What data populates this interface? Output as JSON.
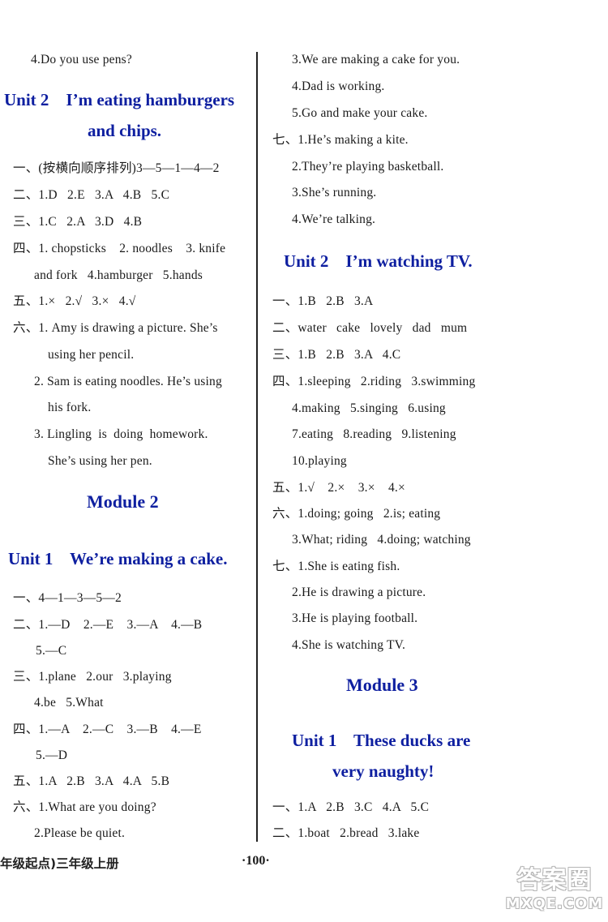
{
  "left_column": {
    "lines": [
      {
        "text": "4.Do you use pens?"
      },
      {
        "heading": "Unit 2    I’m eating hamburgers"
      },
      {
        "heading": "and chips."
      },
      {
        "text": "一、(按横向顺序排列)3—5—1—4—2"
      },
      {
        "text": "二、1.D   2.E   3.A   4.B   5.C"
      },
      {
        "text": "三、1.C   2.A   3.D   4.B"
      },
      {
        "text": "四、1. chopsticks    2. noodles    3. knife"
      },
      {
        "text": "and fork   4.hamburger   5.hands"
      },
      {
        "text": "五、1.×   2.√   3.×   4.√"
      },
      {
        "text": "六、1. Amy is drawing a picture. She’s"
      },
      {
        "text": "using her pencil."
      },
      {
        "text": "2. Sam is eating noodles. He’s using"
      },
      {
        "text": "his fork."
      },
      {
        "text": "3. Lingling  is  doing  homework."
      },
      {
        "text": "She’s using her pen."
      },
      {
        "heading": "Module 2"
      },
      {
        "heading": "Unit 1    We’re making a cake."
      },
      {
        "text": "一、4—1—3—5—2"
      },
      {
        "text": "二、1.—D    2.—E    3.—A    4.—B"
      },
      {
        "text": "5.—C"
      },
      {
        "text": "三、1.plane   2.our   3.playing"
      },
      {
        "text": "4.be   5.What"
      },
      {
        "text": "四、1.—A    2.—C    3.—B    4.—E"
      },
      {
        "text": "5.—D"
      },
      {
        "text": "五、1.A   2.B   3.A   4.A   5.B"
      },
      {
        "text": "六、1.What are you doing?"
      },
      {
        "text": "2.Please be quiet."
      }
    ]
  },
  "right_column": {
    "lines": [
      {
        "text": "3.We are making a cake for you."
      },
      {
        "text": "4.Dad is working."
      },
      {
        "text": "5.Go and make your cake."
      },
      {
        "text": "七、1.He’s making a kite."
      },
      {
        "text": "2.They’re playing basketball."
      },
      {
        "text": "3.She’s running."
      },
      {
        "text": "4.We’re talking."
      },
      {
        "heading": "Unit 2    I’m watching TV."
      },
      {
        "text": "一、1.B   2.B   3.A"
      },
      {
        "text": "二、water   cake   lovely   dad   mum"
      },
      {
        "text": "三、1.B   2.B   3.A   4.C"
      },
      {
        "text": "四、1.sleeping   2.riding   3.swimming"
      },
      {
        "text": "4.making   5.singing   6.using"
      },
      {
        "text": "7.eating   8.reading   9.listening"
      },
      {
        "text": "10.playing"
      },
      {
        "text": "五、1.√    2.×    3.×    4.×"
      },
      {
        "text": "六、1.doing; going   2.is; eating"
      },
      {
        "text": "3.What; riding   4.doing; watching"
      },
      {
        "text": "七、1.She is eating fish."
      },
      {
        "text": "2.He is drawing a picture."
      },
      {
        "text": "3.He is playing football."
      },
      {
        "text": "4.She is watching TV."
      },
      {
        "heading": "Module 3"
      },
      {
        "heading": "Unit 1    These ducks are"
      },
      {
        "heading": "very naughty!"
      },
      {
        "text": "一、1.A   2.B   3.C   4.A   5.C"
      },
      {
        "text": "二、1.boat   2.bread   3.lake"
      }
    ]
  },
  "footer": {
    "book_label": "年级起点)三年级上册",
    "page_number": "·100·"
  },
  "watermark": {
    "cn": "答案圈",
    "en": "MXQE.COM"
  },
  "colors": {
    "heading": "#0e1fa0",
    "text": "#1a1a1a"
  }
}
